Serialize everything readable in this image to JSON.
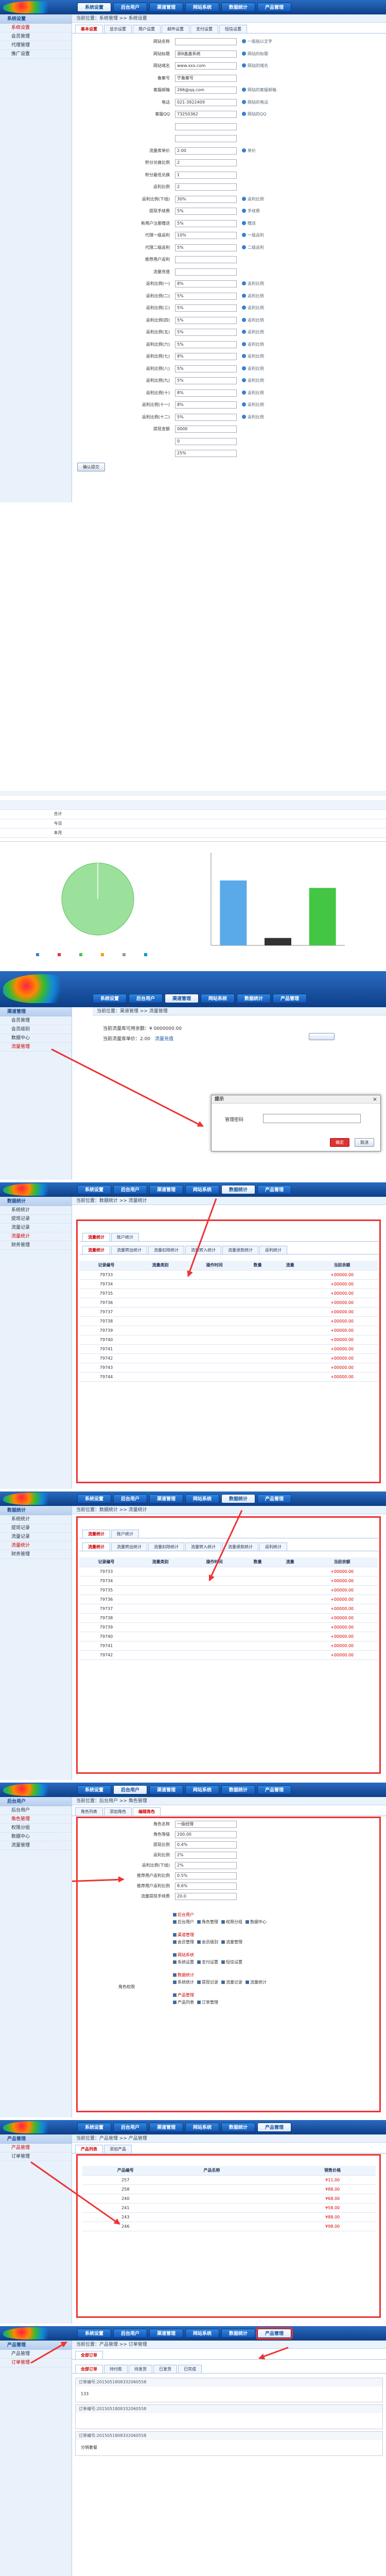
{
  "nav": {
    "tabs": [
      "系统设置",
      "后台用户",
      "渠道管理",
      "网站系统",
      "数据统计",
      "产品管理"
    ]
  },
  "s1": {
    "side_title": "系统设置",
    "side_items": [
      "系统设置",
      "会员管理",
      "代理管理",
      "推广设置"
    ],
    "crumb": "当前位置：系统管理 >> 系统设置",
    "tabs": [
      "基本设置",
      "显示设置",
      "用户设置",
      "邮件设置",
      "支付设置",
      "短信设置"
    ],
    "fields": [
      {
        "label": "网站名称",
        "value": "",
        "hint": "一般指以文字"
      },
      {
        "label": "网站标题",
        "value": "浙B鑫鑫系统",
        "hint": "网站的标题"
      },
      {
        "label": "网站域名",
        "value": "www.xxx.com",
        "hint": "网站的域名"
      },
      {
        "label": "备案号",
        "value": "宁备案号",
        "hint": ""
      },
      {
        "label": "客服邮箱",
        "value": "266@qq.com",
        "hint": "网站的客服邮箱"
      },
      {
        "label": "电话",
        "value": "021-3922409",
        "hint": "网站的电话"
      },
      {
        "label": "客服QQ",
        "value": "73250362",
        "hint": "网站的QQ"
      },
      {
        "label": "",
        "value": "",
        "hint": ""
      },
      {
        "label": "",
        "value": "",
        "hint": ""
      },
      {
        "label": "流量库单价",
        "value": "2.00",
        "hint": "单价"
      },
      {
        "label": "积分兑换比例",
        "value": "2",
        "hint": ""
      },
      {
        "label": "积分最低兑换",
        "value": "1",
        "hint": ""
      },
      {
        "label": "返利比例",
        "value": "2",
        "hint": ""
      },
      {
        "label": "返利比例(下线)",
        "value": "30%",
        "hint": "返利比例"
      },
      {
        "label": "提现手续费",
        "value": "5%",
        "hint": "手续费"
      },
      {
        "label": "新用户注册赠送",
        "value": "5%",
        "hint": "赠送"
      },
      {
        "label": "代理一级返利",
        "value": "10%",
        "hint": "一级返利"
      },
      {
        "label": "代理二级返利",
        "value": "5%",
        "hint": "二级返利"
      },
      {
        "label": "推荐用户返利",
        "value": "",
        "hint": ""
      },
      {
        "label": "流量充值",
        "value": "",
        "hint": ""
      },
      {
        "label": "返利比例(一)",
        "value": "8%",
        "hint": "返利比例"
      },
      {
        "label": "返利比例(二)",
        "value": "5%",
        "hint": "返利比例"
      },
      {
        "label": "返利比例(三)",
        "value": "5%",
        "hint": "返利比例"
      },
      {
        "label": "返利比例(四)",
        "value": "5%",
        "hint": "返利比例"
      },
      {
        "label": "返利比例(五)",
        "value": "5%",
        "hint": "返利比例"
      },
      {
        "label": "返利比例(六)",
        "value": "5%",
        "hint": "返利比例"
      },
      {
        "label": "返利比例(七)",
        "value": "8%",
        "hint": "返利比例"
      },
      {
        "label": "返利比例(八)",
        "value": "5%",
        "hint": "返利比例"
      },
      {
        "label": "返利比例(九)",
        "value": "5%",
        "hint": "返利比例"
      },
      {
        "label": "返利比例(十)",
        "value": "8%",
        "hint": "返利比例"
      },
      {
        "label": "返利比例(十一)",
        "value": "8%",
        "hint": "返利比例"
      },
      {
        "label": "返利比例(十二)",
        "value": "5%",
        "hint": "返利比例"
      },
      {
        "label": "提现金额",
        "value": "0000",
        "hint": ""
      },
      {
        "label": "",
        "value": "0",
        "hint": ""
      },
      {
        "label": "",
        "value": "25%",
        "hint": ""
      }
    ],
    "submit": "确认提交"
  },
  "s2": {
    "table_head": [
      "",
      "",
      "",
      "",
      "",
      "",
      "",
      ""
    ],
    "rows": [
      [
        "合计",
        "",
        "",
        "",
        "",
        "",
        "",
        ""
      ],
      [
        "今日",
        "",
        "",
        "",
        "",
        "",
        "",
        ""
      ],
      [
        "本月",
        "",
        "",
        "",
        "",
        "",
        "",
        ""
      ]
    ],
    "pie_caption": "",
    "legend": [
      "",
      "",
      "",
      "",
      "",
      ""
    ]
  },
  "s3": {
    "side_title": "渠道管理",
    "side_items": [
      "会员管理",
      "会员级别",
      "数据中心",
      "流量管理"
    ],
    "crumb": "当前位置：渠道管理 >> 流量管理",
    "line1_label": "当前流量库可用余额：",
    "line1_value": "¥ 0000000.00",
    "line2_label": "当前流量库单价：",
    "line2_value": "2.00",
    "line2_extra": "流量充值",
    "btn": "",
    "dialog_title": "提示",
    "dialog_label": "管理密码",
    "dialog_ok": "确定",
    "dialog_cancel": "取消"
  },
  "s4": {
    "side_title": "数据统计",
    "side_items": [
      "系统统计",
      "提现记录",
      "流量记录",
      "流量统计",
      "财务管理"
    ],
    "crumb": "当前位置：数据统计 >> 流量统计",
    "tabs": [
      "流量统计",
      "账户统计"
    ],
    "subtabs": [
      "流量统计",
      "流量转出统计",
      "流量扣除统计",
      "流量转入统计",
      "流量退款统计",
      "返利统计"
    ],
    "head": [
      "记录编号",
      "流量类别",
      "操作时间",
      "数量",
      "流量",
      "当前余额"
    ],
    "rows": [
      [
        "79733",
        "",
        "",
        "",
        "",
        "+00000.00"
      ],
      [
        "79734",
        "",
        "",
        "",
        "",
        "+00000.00"
      ],
      [
        "79735",
        "",
        "",
        "",
        "",
        "+00000.00"
      ],
      [
        "79736",
        "",
        "",
        "",
        "",
        "+00000.00"
      ],
      [
        "79737",
        "",
        "",
        "",
        "",
        "+00000.00"
      ],
      [
        "79738",
        "",
        "",
        "",
        "",
        "+00000.00"
      ],
      [
        "79739",
        "",
        "",
        "",
        "",
        "+00000.00"
      ],
      [
        "79740",
        "",
        "",
        "",
        "",
        "+00000.00"
      ],
      [
        "79741",
        "",
        "",
        "",
        "",
        "+00000.00"
      ],
      [
        "79742",
        "",
        "",
        "",
        "",
        "+00000.00"
      ],
      [
        "79743",
        "",
        "",
        "",
        "",
        "+00000.00"
      ],
      [
        "79744",
        "",
        "",
        "",
        "",
        "+00000.00"
      ]
    ]
  },
  "s5": {
    "side_title": "数据统计",
    "side_items": [
      "系统统计",
      "提现记录",
      "流量记录",
      "流量统计",
      "财务管理"
    ],
    "crumb": "当前位置：数据统计 >> 流量统计",
    "tabs": [
      "流量统计",
      "账户统计"
    ],
    "subtabs": [
      "流量统计",
      "流量转出统计",
      "流量扣除统计",
      "流量转入统计",
      "流量退款统计",
      "返利统计"
    ],
    "head": [
      "记录编号",
      "流量类别",
      "操作时间",
      "数量",
      "流量",
      "当前余额"
    ],
    "rows": [
      [
        "79733",
        "",
        "",
        "",
        "",
        "+00000.00"
      ],
      [
        "79734",
        "",
        "",
        "",
        "",
        "+00000.00"
      ],
      [
        "79735",
        "",
        "",
        "",
        "",
        "+00000.00"
      ],
      [
        "79736",
        "",
        "",
        "",
        "",
        "+00000.00"
      ],
      [
        "79737",
        "",
        "",
        "",
        "",
        "+00000.00"
      ],
      [
        "79738",
        "",
        "",
        "",
        "",
        "+00000.00"
      ],
      [
        "79739",
        "",
        "",
        "",
        "",
        "+00000.00"
      ],
      [
        "79740",
        "",
        "",
        "",
        "",
        "+00000.00"
      ],
      [
        "79741",
        "",
        "",
        "",
        "",
        "+00000.00"
      ],
      [
        "79742",
        "",
        "",
        "",
        "",
        "+00000.00"
      ]
    ]
  },
  "s6": {
    "side_title": "后台用户",
    "side_items": [
      "后台用户",
      "角色管理",
      "权限分组",
      "数据中心",
      "流量管理"
    ],
    "crumb": "当前位置：后台用户 >> 角色管理",
    "tabs": [
      "角色列表",
      "添加角色",
      "编辑角色"
    ],
    "fields": [
      {
        "label": "角色名称",
        "value": "一级经理"
      },
      {
        "label": "角色等级",
        "value": "200.00"
      },
      {
        "label": "提现比例",
        "value": "0.4%"
      },
      {
        "label": "返利比例",
        "value": "2%"
      },
      {
        "label": "返利比例(下线)",
        "value": "2%"
      },
      {
        "label": "推荐用户返利比例",
        "value": "0.5%"
      },
      {
        "label": "推荐用户返利比例",
        "value": "8.6%"
      },
      {
        "label": "流量提现手续费",
        "value": "20.0"
      }
    ],
    "perm_label": "角色权限",
    "perm_groups": [
      {
        "name": "后台用户",
        "items": [
          "后台用户",
          "角色管理",
          "权限分组",
          "数据中心"
        ]
      },
      {
        "name": "渠道管理",
        "items": [
          "会员管理",
          "会员级别",
          "流量管理"
        ]
      },
      {
        "name": "网站系统",
        "items": [
          "系统设置",
          "支付设置",
          "短信设置"
        ]
      },
      {
        "name": "数据统计",
        "items": [
          "系统统计",
          "提现记录",
          "流量记录",
          "流量统计"
        ]
      },
      {
        "name": "产品管理",
        "items": [
          "产品列表",
          "订单管理"
        ]
      }
    ]
  },
  "s7": {
    "side_title": "产品管理",
    "side_items": [
      "产品管理",
      "订单管理"
    ],
    "crumb": "当前位置：产品管理 >> 产品管理",
    "tabs": [
      "产品列表",
      "添加产品"
    ],
    "head": [
      "产品编号",
      "产品名称",
      "",
      "",
      "销售价格"
    ],
    "rows": [
      [
        "257",
        "",
        "",
        "",
        "¥11.00"
      ],
      [
        "258",
        "",
        "",
        "",
        "¥88.00"
      ],
      [
        "240",
        "",
        "",
        "",
        "¥68.00"
      ],
      [
        "241",
        "",
        "",
        "",
        "¥58.00"
      ],
      [
        "243",
        "",
        "",
        "",
        "¥88.00"
      ],
      [
        "246",
        "",
        "",
        "",
        "¥98.00"
      ]
    ]
  },
  "s8": {
    "side_title": "产品管理",
    "side_items": [
      "产品管理",
      "订单管理"
    ],
    "crumb": "当前位置：产品管理 >> 订单管理",
    "tabs": [
      "全部订单"
    ],
    "filters": [
      "全部订单",
      "待付款",
      "待发货",
      "已发货",
      "已完成"
    ],
    "orders": [
      {
        "head": "订单编号:2015051808332060558",
        "body": "133"
      },
      {
        "head": "订单编号:2015051808332060558",
        "body": ""
      },
      {
        "head": "订单编号:2015051808332060558",
        "body": "分销套餐"
      }
    ]
  },
  "chart_data": {
    "type": "bar",
    "categories": [
      "",
      "",
      ""
    ],
    "values": [
      70,
      8,
      62
    ],
    "title": "",
    "xlabel": "",
    "ylabel": "",
    "ylim": [
      0,
      100
    ],
    "colors": [
      "#5aaaea",
      "#333333",
      "#44c644"
    ]
  }
}
